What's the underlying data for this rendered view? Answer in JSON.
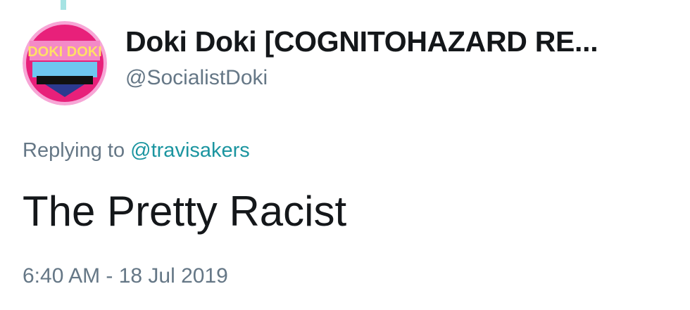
{
  "tweet": {
    "display_name": "Doki Doki [COGNITOHAZARD RE...",
    "handle": "@SocialistDoki",
    "avatar_text": "DOKI DOKI",
    "replying_prefix": "Replying to",
    "replying_to": "@travisakers",
    "text": "The Pretty Racist",
    "timestamp": "6:40 AM - 18 Jul 2019"
  },
  "colors": {
    "name": "#14171a",
    "secondary": "#657786",
    "mention": "#1b95a0",
    "thread_line": "#a6e3e3"
  }
}
